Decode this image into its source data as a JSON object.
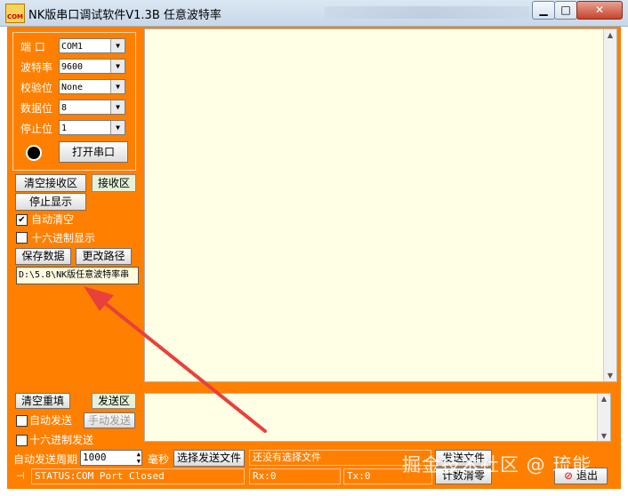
{
  "window": {
    "title": "NK版串口调试软件V1.3B  任意波特率",
    "icon_text": "COM",
    "controls": {
      "min": "▁",
      "max": "□",
      "close": "✕"
    }
  },
  "port_settings": {
    "port_label": "端  口",
    "port_value": "COM1",
    "baud_label": "波特率",
    "baud_value": "9600",
    "parity_label": "校验位",
    "parity_value": "None",
    "databits_label": "数据位",
    "databits_value": "8",
    "stopbits_label": "停止位",
    "stopbits_value": "1",
    "open_button": "打开串口"
  },
  "receive_controls": {
    "clear_button": "清空接收区",
    "receive_area_tag": "接收区",
    "stop_button": "停止显示",
    "auto_clear_label": "自动清空",
    "auto_clear_checked": true,
    "hex_display_label": "十六进制显示",
    "hex_display_checked": false,
    "save_button": "保存数据",
    "change_path_button": "更改路径",
    "path_value": "D:\\5.8\\NK版任意波特率串"
  },
  "send_controls": {
    "clear_resend_button": "清空重填",
    "send_area_tag": "发送区",
    "auto_send_label": "自动发送",
    "auto_send_checked": false,
    "manual_send_button": "手动发送",
    "hex_send_label": "十六进制发送",
    "hex_send_checked": false,
    "period_label": "自动发送周期",
    "period_value": "1000",
    "ms_label": "毫秒",
    "select_file_button": "选择发送文件",
    "file_status": "还没有选择文件",
    "send_file_button": "发送文件",
    "count_clear_button": "计数清零",
    "exit_button": "退出"
  },
  "status_bar": {
    "status_text": "STATUS:COM Port Closed",
    "rx_text": "Rx:0",
    "tx_text": "Tx:0"
  },
  "watermark": "掘金技术社区 @ 琉能",
  "colors": {
    "window_orange": "#ff8000",
    "text_area_bg": "#ffffe6",
    "annotation_arrow": "#e8413b"
  }
}
